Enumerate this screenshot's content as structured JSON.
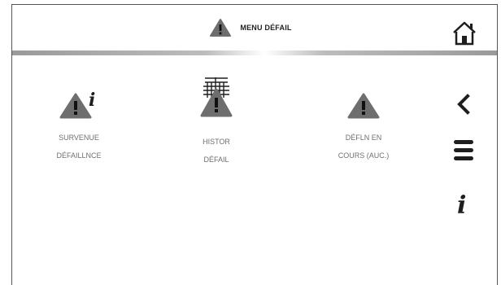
{
  "header": {
    "title": "MENU DÉFAIL"
  },
  "menu": {
    "items": [
      {
        "line1": "SURVENUE",
        "line2": "DÉFAILLNCE"
      },
      {
        "line1": "HISTOR",
        "line2": "DÉFAIL"
      },
      {
        "line1": "DÉFLN EN",
        "line2": "COURS (AUC.)"
      }
    ]
  },
  "colors": {
    "warning_gray": "#6e6e6e",
    "dark": "#1e1e1e",
    "label_gray": "#6f6f6f"
  },
  "icons": [
    "warning-icon",
    "home-icon",
    "info-icon",
    "calendar-icon",
    "back-icon",
    "menu-icon"
  ]
}
